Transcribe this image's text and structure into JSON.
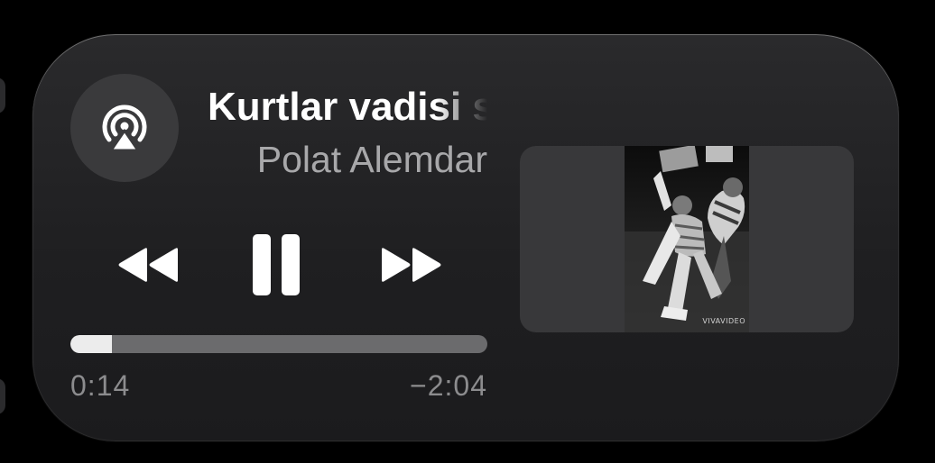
{
  "now_playing": {
    "title": "Kurtlar vadisi s",
    "artist": "Polat Alemdar",
    "elapsed": "0:14",
    "remaining": "−2:04",
    "progress_fraction": 0.1
  },
  "controls": {
    "airplay_icon": "airplay-audio-icon",
    "rewind_icon": "rewind-icon",
    "pause_icon": "pause-icon",
    "forward_icon": "fast-forward-icon"
  },
  "video": {
    "watermark": "VIVAVIDEO"
  },
  "colors": {
    "background": "#000000",
    "card": "#242426",
    "airplay_button": "#3a3a3c",
    "title": "#ffffff",
    "artist": "#a8a8aa",
    "time": "#8c8c8e",
    "progress_track": "#6b6b6d",
    "progress_fill": "#ececec"
  }
}
